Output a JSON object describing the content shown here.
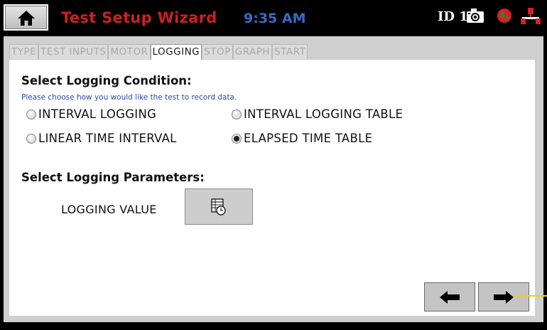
{
  "header": {
    "title": "Test Setup Wizard",
    "time": "9:35 AM",
    "id_label": "ID 1",
    "icons": [
      "home-icon",
      "camera-icon",
      "status-globe-icon",
      "network-icon"
    ],
    "title_color": "#cc2020",
    "time_color": "#3c68c8"
  },
  "tabs": [
    {
      "label": "TYPE",
      "active": false
    },
    {
      "label": "TEST INPUTS",
      "active": false
    },
    {
      "label": "MOTOR",
      "active": false
    },
    {
      "label": "LOGGING",
      "active": true
    },
    {
      "label": "STOP",
      "active": false
    },
    {
      "label": "GRAPH",
      "active": false
    },
    {
      "label": "START",
      "active": false
    }
  ],
  "logging_condition": {
    "title": "Select Logging Condition:",
    "hint": "Please choose how you would like the test to record data.",
    "options": [
      {
        "label": "INTERVAL LOGGING",
        "checked": false
      },
      {
        "label": "INTERVAL LOGGING TABLE",
        "checked": false
      },
      {
        "label": "LINEAR TIME INTERVAL",
        "checked": false
      },
      {
        "label": "ELAPSED TIME TABLE",
        "checked": true
      }
    ]
  },
  "logging_parameters": {
    "title": "Select Logging Parameters:",
    "value_label": "LOGGING VALUE",
    "value_button_icon": "table-clock-icon"
  },
  "navigation": {
    "back_icon": "arrow-left-icon",
    "next_icon": "arrow-right-icon"
  }
}
